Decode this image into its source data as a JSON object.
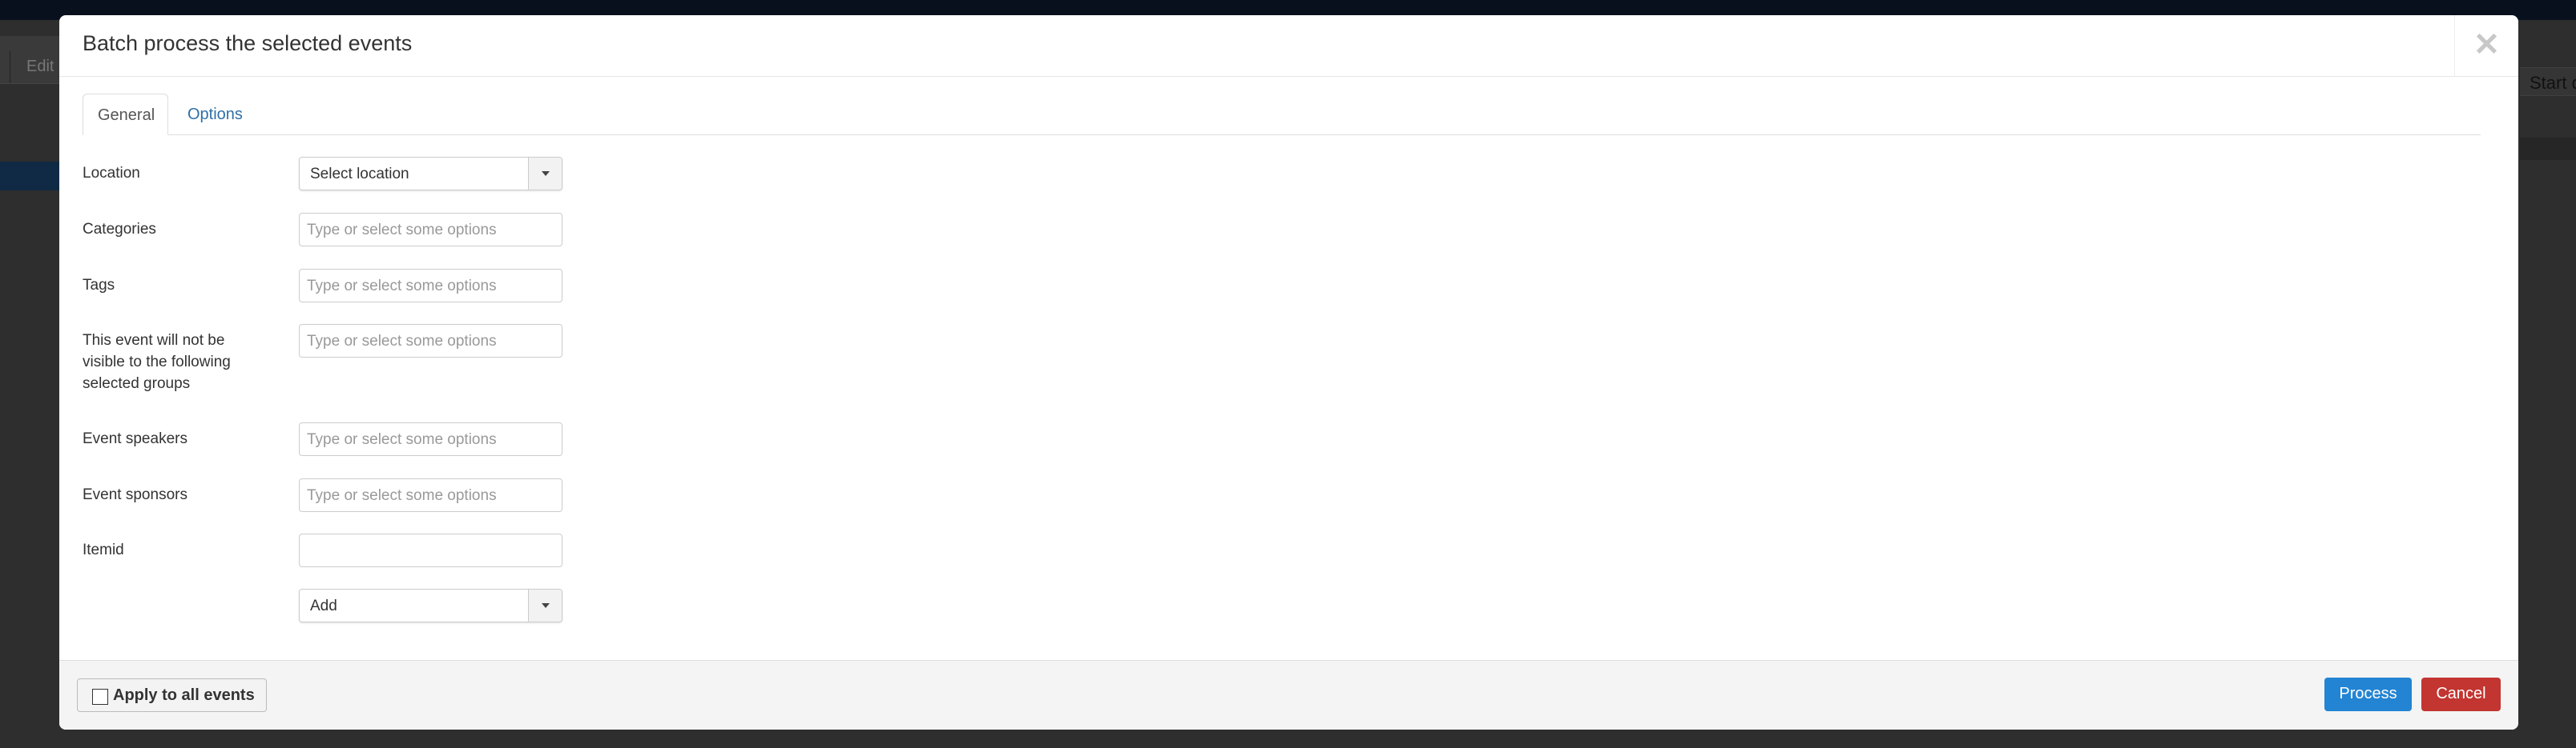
{
  "background": {
    "edit_label": "Edit",
    "column_header": "Start d"
  },
  "modal": {
    "title": "Batch process the selected events",
    "close_icon": "close-icon",
    "tabs": [
      {
        "label": "General",
        "active": true
      },
      {
        "label": "Options",
        "active": false
      }
    ],
    "fields": {
      "location": {
        "label": "Location",
        "value": "Select location"
      },
      "categories": {
        "label": "Categories",
        "placeholder": "Type or select some options"
      },
      "tags": {
        "label": "Tags",
        "placeholder": "Type or select some options"
      },
      "groups": {
        "label": "This event will not be visible to the following selected groups",
        "placeholder": "Type or select some options"
      },
      "speakers": {
        "label": "Event speakers",
        "placeholder": "Type or select some options"
      },
      "sponsors": {
        "label": "Event sponsors",
        "placeholder": "Type or select some options"
      },
      "itemid": {
        "label": "Itemid",
        "value": ""
      },
      "mode": {
        "value": "Add"
      }
    },
    "footer": {
      "apply_label": "Apply to all events",
      "apply_checked": false,
      "process_label": "Process",
      "cancel_label": "Cancel"
    },
    "colors": {
      "process": "#2384d3",
      "cancel": "#c23530",
      "tab_link": "#2f6fa8"
    }
  }
}
